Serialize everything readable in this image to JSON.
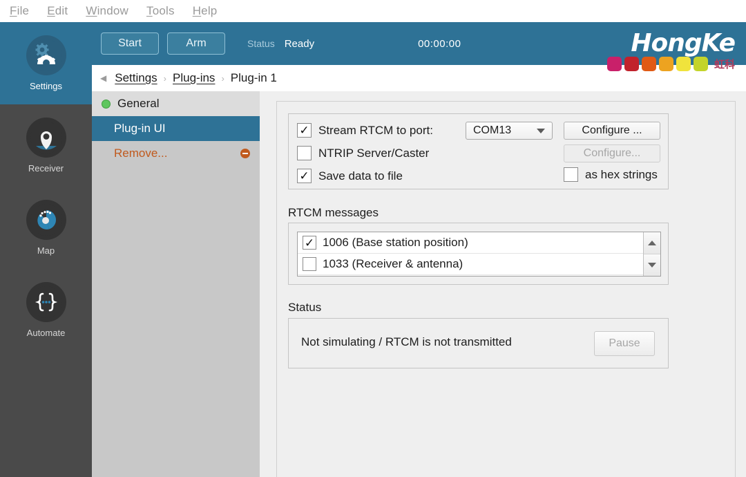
{
  "menubar": {
    "items": [
      {
        "accel": "F",
        "rest": "ile"
      },
      {
        "accel": "E",
        "rest": "dit"
      },
      {
        "accel": "W",
        "rest": "indow"
      },
      {
        "accel": "T",
        "rest": "ools"
      },
      {
        "accel": "H",
        "rest": "elp"
      }
    ]
  },
  "rail": {
    "items": [
      {
        "label": "Settings",
        "icon": "gears-icon",
        "active": true
      },
      {
        "label": "Receiver",
        "icon": "map-pin-icon",
        "active": false
      },
      {
        "label": "Map",
        "icon": "globe-icon",
        "active": false
      },
      {
        "label": "Automate",
        "icon": "curly-braces-icon",
        "active": false
      }
    ]
  },
  "header": {
    "start_label": "Start",
    "arm_label": "Arm",
    "status_label": "Status",
    "status_value": "Ready",
    "timer": "00:00:00",
    "logo_text": "HongKe",
    "logo_cn": "虹科",
    "logo_colors": [
      "#c9206a",
      "#c1222c",
      "#e05a15",
      "#eda320",
      "#f0e33c",
      "#c3d42a"
    ],
    "accent_blue": "#2e7296"
  },
  "breadcrumb": {
    "back_icon": "back-arrow-icon",
    "crumbs": [
      "Settings",
      "Plug-ins",
      "Plug-in 1"
    ],
    "separator": "›"
  },
  "navpanel": {
    "items": [
      {
        "label": "General",
        "state": "normal",
        "icon": "green-status-dot"
      },
      {
        "label": "Plug-in UI",
        "state": "selected",
        "icon": ""
      },
      {
        "label": "Remove...",
        "state": "remove",
        "icon": "minus-circle-icon"
      }
    ]
  },
  "content": {
    "options": {
      "stream_label": "Stream RTCM to port:",
      "stream_checked": "✓",
      "port_value": "COM13",
      "configure1_label": "Configure ...",
      "ntrip_label": "NTRIP Server/Caster",
      "ntrip_checked": "",
      "configure2_label": "Configure...",
      "save_label": "Save data to file",
      "save_checked": "✓",
      "hex_label": "as hex strings",
      "hex_checked": ""
    },
    "messages": {
      "title": "RTCM messages",
      "rows": [
        {
          "checked": "✓",
          "label": "1006 (Base station position)"
        },
        {
          "checked": "",
          "label": "1033 (Receiver & antenna)"
        }
      ]
    },
    "status": {
      "title": "Status",
      "text": "Not simulating / RTCM is not transmitted",
      "pause_label": "Pause"
    }
  }
}
